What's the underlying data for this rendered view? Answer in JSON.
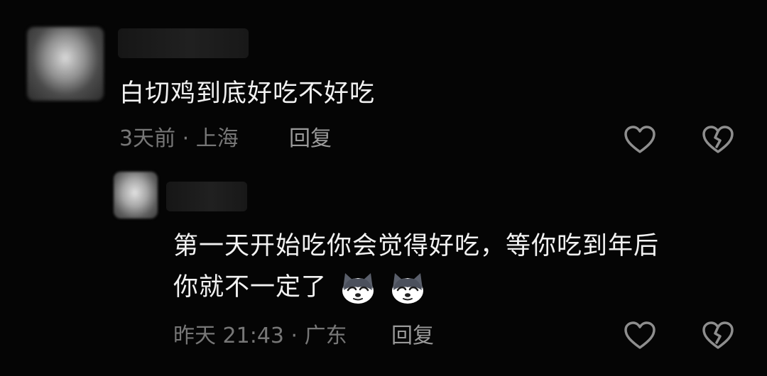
{
  "comment": {
    "text": "白切鸡到底好吃不好吃",
    "meta": "3天前 · 上海",
    "reply_label": "回复"
  },
  "reply": {
    "text_line1": "第一天开始吃你会觉得好吃，等你吃到年后",
    "text_line2": "你就不一定了",
    "emojis": [
      "husky-dog-emoji",
      "husky-dog-emoji"
    ],
    "meta": "昨天 21:43 · 广东",
    "reply_label": "回复"
  },
  "colors": {
    "background": "#050505",
    "body_text": "#f2f2f2",
    "meta_text": "#777777",
    "icon": "#8e8e8e"
  },
  "icons": {
    "like": "heart-outline-icon",
    "dislike": "broken-heart-icon"
  }
}
